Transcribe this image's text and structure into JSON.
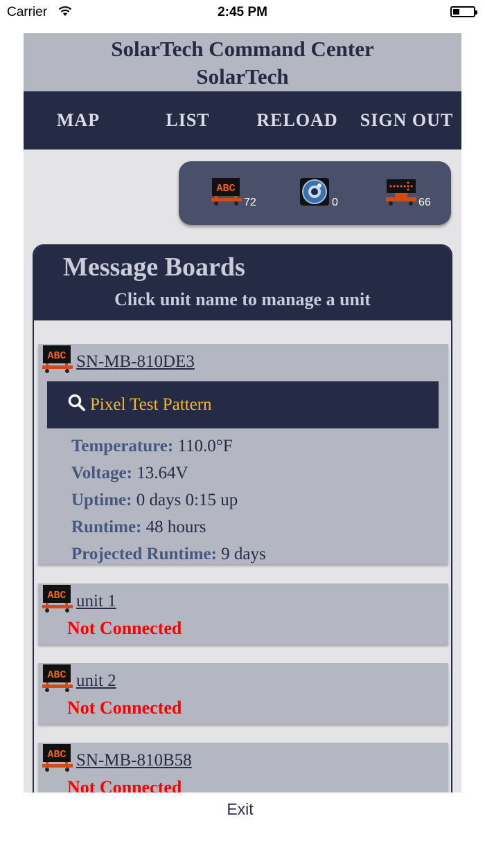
{
  "status_bar": {
    "carrier": "Carrier",
    "time": "2:45 PM"
  },
  "header": {
    "title": "SolarTech Command Center",
    "subtitle": "SolarTech"
  },
  "nav": {
    "items": [
      "MAP",
      "LIST",
      "RELOAD",
      "SIGN OUT"
    ]
  },
  "counts": {
    "message_boards": "72",
    "cameras": "0",
    "arrow_boards": "66"
  },
  "panel": {
    "title": "Message Boards",
    "subtitle": "Click unit name to manage a unit"
  },
  "units": [
    {
      "name": "SN-MB-810DE3",
      "action": "Pixel Test Pattern",
      "details": [
        {
          "label": "Temperature:",
          "value": "110.0°F"
        },
        {
          "label": "Voltage:",
          "value": "13.64V"
        },
        {
          "label": "Uptime:",
          "value": "0 days 0:15 up"
        },
        {
          "label": "Runtime:",
          "value": "48 hours"
        },
        {
          "label": "Projected Runtime:",
          "value": "9 days"
        }
      ]
    },
    {
      "name": "unit 1",
      "status": "Not Connected"
    },
    {
      "name": "unit 2",
      "status": "Not Connected"
    },
    {
      "name": "SN-MB-810B58",
      "status": "Not Connected"
    }
  ],
  "footer": {
    "exit_label": "Exit"
  },
  "colors": {
    "navy": "#262b45",
    "header_gray": "#b4b6c1",
    "accent_orange": "#f6b629",
    "status_red": "#ff0000"
  }
}
